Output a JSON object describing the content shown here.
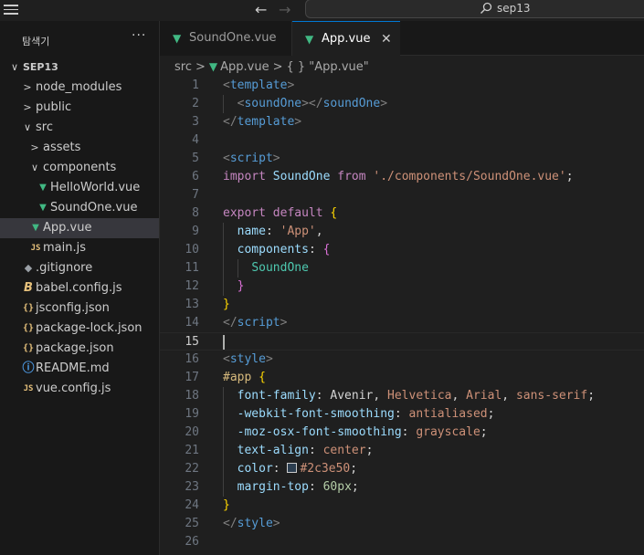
{
  "titlebar": {
    "search_text": "sep13",
    "back_icon": "←",
    "forward_icon": "→"
  },
  "sidebar": {
    "title": "탐색기",
    "more_icon": "···",
    "tree": [
      {
        "label": "SEP13",
        "kind": "root",
        "chevron": "∨",
        "depth": 0
      },
      {
        "label": "node_modules",
        "kind": "folder",
        "chevron": ">",
        "depth": 1
      },
      {
        "label": "public",
        "kind": "folder",
        "chevron": ">",
        "depth": 1
      },
      {
        "label": "src",
        "kind": "folder",
        "chevron": "∨",
        "depth": 1
      },
      {
        "label": "assets",
        "kind": "folder",
        "chevron": ">",
        "depth": 2
      },
      {
        "label": "components",
        "kind": "folder",
        "chevron": "∨",
        "depth": 2
      },
      {
        "label": "HelloWorld.vue",
        "kind": "vue",
        "icon": "▼",
        "depth": 3
      },
      {
        "label": "SoundOne.vue",
        "kind": "vue",
        "icon": "▼",
        "depth": 3
      },
      {
        "label": "App.vue",
        "kind": "vue",
        "icon": "▼",
        "depth": 2,
        "selected": true
      },
      {
        "label": "main.js",
        "kind": "js",
        "icon": "JS",
        "depth": 2
      },
      {
        "label": ".gitignore",
        "kind": "git",
        "icon": "◆",
        "depth": 1
      },
      {
        "label": "babel.config.js",
        "kind": "babel",
        "icon": "B",
        "depth": 1
      },
      {
        "label": "jsconfig.json",
        "kind": "json",
        "icon": "{}",
        "depth": 1
      },
      {
        "label": "package-lock.json",
        "kind": "json",
        "icon": "{}",
        "depth": 1
      },
      {
        "label": "package.json",
        "kind": "json",
        "icon": "{}",
        "depth": 1
      },
      {
        "label": "README.md",
        "kind": "info",
        "icon": "ⓘ",
        "depth": 1
      },
      {
        "label": "vue.config.js",
        "kind": "js",
        "icon": "JS",
        "depth": 1
      }
    ]
  },
  "tabs": [
    {
      "label": "SoundOne.vue",
      "icon": "▼",
      "active": false
    },
    {
      "label": "App.vue",
      "icon": "▼",
      "active": true,
      "close": "✕"
    }
  ],
  "breadcrumb": {
    "folder": "src",
    "file": "App.vue",
    "symbol": "{ } \"App.vue\""
  },
  "editor": {
    "current_line": 15,
    "lines": [
      {
        "n": "1",
        "tokens": [
          [
            "tk-br",
            "<"
          ],
          [
            "tk-tag",
            "template"
          ],
          [
            "tk-br",
            ">"
          ]
        ]
      },
      {
        "n": "2",
        "tokens": [
          [
            "tk-txt",
            "  "
          ],
          [
            "tk-br",
            "<"
          ],
          [
            "tk-tag",
            "soundOne"
          ],
          [
            "tk-br",
            "></"
          ],
          [
            "tk-tag",
            "soundOne"
          ],
          [
            "tk-br",
            ">"
          ]
        ]
      },
      {
        "n": "3",
        "tokens": [
          [
            "tk-br",
            "</"
          ],
          [
            "tk-tag",
            "template"
          ],
          [
            "tk-br",
            ">"
          ]
        ]
      },
      {
        "n": "4",
        "tokens": []
      },
      {
        "n": "5",
        "tokens": [
          [
            "tk-br",
            "<"
          ],
          [
            "tk-tag",
            "script"
          ],
          [
            "tk-br",
            ">"
          ]
        ]
      },
      {
        "n": "6",
        "tokens": [
          [
            "tk-kw",
            "import"
          ],
          [
            "tk-txt",
            " "
          ],
          [
            "tk-id",
            "SoundOne"
          ],
          [
            "tk-txt",
            " "
          ],
          [
            "tk-kw",
            "from"
          ],
          [
            "tk-txt",
            " "
          ],
          [
            "tk-str",
            "'./components/SoundOne.vue'"
          ],
          [
            "tk-txt",
            ";"
          ]
        ]
      },
      {
        "n": "7",
        "tokens": []
      },
      {
        "n": "8",
        "tokens": [
          [
            "tk-kw",
            "export"
          ],
          [
            "tk-txt",
            " "
          ],
          [
            "tk-kw",
            "default"
          ],
          [
            "tk-txt",
            " "
          ],
          [
            "tk-b1",
            "{"
          ]
        ]
      },
      {
        "n": "9",
        "tokens": [
          [
            "tk-txt",
            "  "
          ],
          [
            "tk-id",
            "name"
          ],
          [
            "tk-txt",
            ": "
          ],
          [
            "tk-str",
            "'App'"
          ],
          [
            "tk-txt",
            ","
          ]
        ]
      },
      {
        "n": "10",
        "tokens": [
          [
            "tk-txt",
            "  "
          ],
          [
            "tk-id",
            "components"
          ],
          [
            "tk-txt",
            ": "
          ],
          [
            "tk-b2",
            "{"
          ]
        ]
      },
      {
        "n": "11",
        "tokens": [
          [
            "tk-txt",
            "    "
          ],
          [
            "tk-comp",
            "SoundOne"
          ]
        ]
      },
      {
        "n": "12",
        "tokens": [
          [
            "tk-txt",
            "  "
          ],
          [
            "tk-b2",
            "}"
          ]
        ]
      },
      {
        "n": "13",
        "tokens": [
          [
            "tk-b1",
            "}"
          ]
        ]
      },
      {
        "n": "14",
        "tokens": [
          [
            "tk-br",
            "</"
          ],
          [
            "tk-tag",
            "script"
          ],
          [
            "tk-br",
            ">"
          ]
        ]
      },
      {
        "n": "15",
        "tokens": []
      },
      {
        "n": "16",
        "tokens": [
          [
            "tk-br",
            "<"
          ],
          [
            "tk-tag",
            "style"
          ],
          [
            "tk-br",
            ">"
          ]
        ]
      },
      {
        "n": "17",
        "tokens": [
          [
            "tk-sel",
            "#app"
          ],
          [
            "tk-txt",
            " "
          ],
          [
            "tk-b1",
            "{"
          ]
        ]
      },
      {
        "n": "18",
        "tokens": [
          [
            "tk-txt",
            "  "
          ],
          [
            "tk-id",
            "font-family"
          ],
          [
            "tk-txt",
            ": Avenir, "
          ],
          [
            "tk-str",
            "Helvetica"
          ],
          [
            "tk-txt",
            ", "
          ],
          [
            "tk-str",
            "Arial"
          ],
          [
            "tk-txt",
            ", "
          ],
          [
            "tk-str",
            "sans-serif"
          ],
          [
            "tk-txt",
            ";"
          ]
        ]
      },
      {
        "n": "19",
        "tokens": [
          [
            "tk-txt",
            "  "
          ],
          [
            "tk-id",
            "-webkit-font-smoothing"
          ],
          [
            "tk-txt",
            ": "
          ],
          [
            "tk-str",
            "antialiased"
          ],
          [
            "tk-txt",
            ";"
          ]
        ]
      },
      {
        "n": "20",
        "tokens": [
          [
            "tk-txt",
            "  "
          ],
          [
            "tk-id",
            "-moz-osx-font-smoothing"
          ],
          [
            "tk-txt",
            ": "
          ],
          [
            "tk-str",
            "grayscale"
          ],
          [
            "tk-txt",
            ";"
          ]
        ]
      },
      {
        "n": "21",
        "tokens": [
          [
            "tk-txt",
            "  "
          ],
          [
            "tk-id",
            "text-align"
          ],
          [
            "tk-txt",
            ": "
          ],
          [
            "tk-str",
            "center"
          ],
          [
            "tk-txt",
            ";"
          ]
        ]
      },
      {
        "n": "22",
        "tokens": [
          [
            "tk-txt",
            "  "
          ],
          [
            "tk-id",
            "color"
          ],
          [
            "tk-txt",
            ": "
          ],
          [
            "swatch",
            "#2c3e50"
          ],
          [
            "tk-str",
            "#2c3e50"
          ],
          [
            "tk-txt",
            ";"
          ]
        ]
      },
      {
        "n": "23",
        "tokens": [
          [
            "tk-txt",
            "  "
          ],
          [
            "tk-id",
            "margin-top"
          ],
          [
            "tk-txt",
            ": "
          ],
          [
            "tk-num",
            "60px"
          ],
          [
            "tk-txt",
            ";"
          ]
        ]
      },
      {
        "n": "24",
        "tokens": [
          [
            "tk-b1",
            "}"
          ]
        ]
      },
      {
        "n": "25",
        "tokens": [
          [
            "tk-br",
            "</"
          ],
          [
            "tk-tag",
            "style"
          ],
          [
            "tk-br",
            ">"
          ]
        ]
      },
      {
        "n": "26",
        "tokens": []
      }
    ]
  },
  "colors": {
    "accent": "#0078d4",
    "vue_green": "#41b883",
    "editor_bg": "#1f1f1f",
    "sidebar_bg": "#181818"
  }
}
